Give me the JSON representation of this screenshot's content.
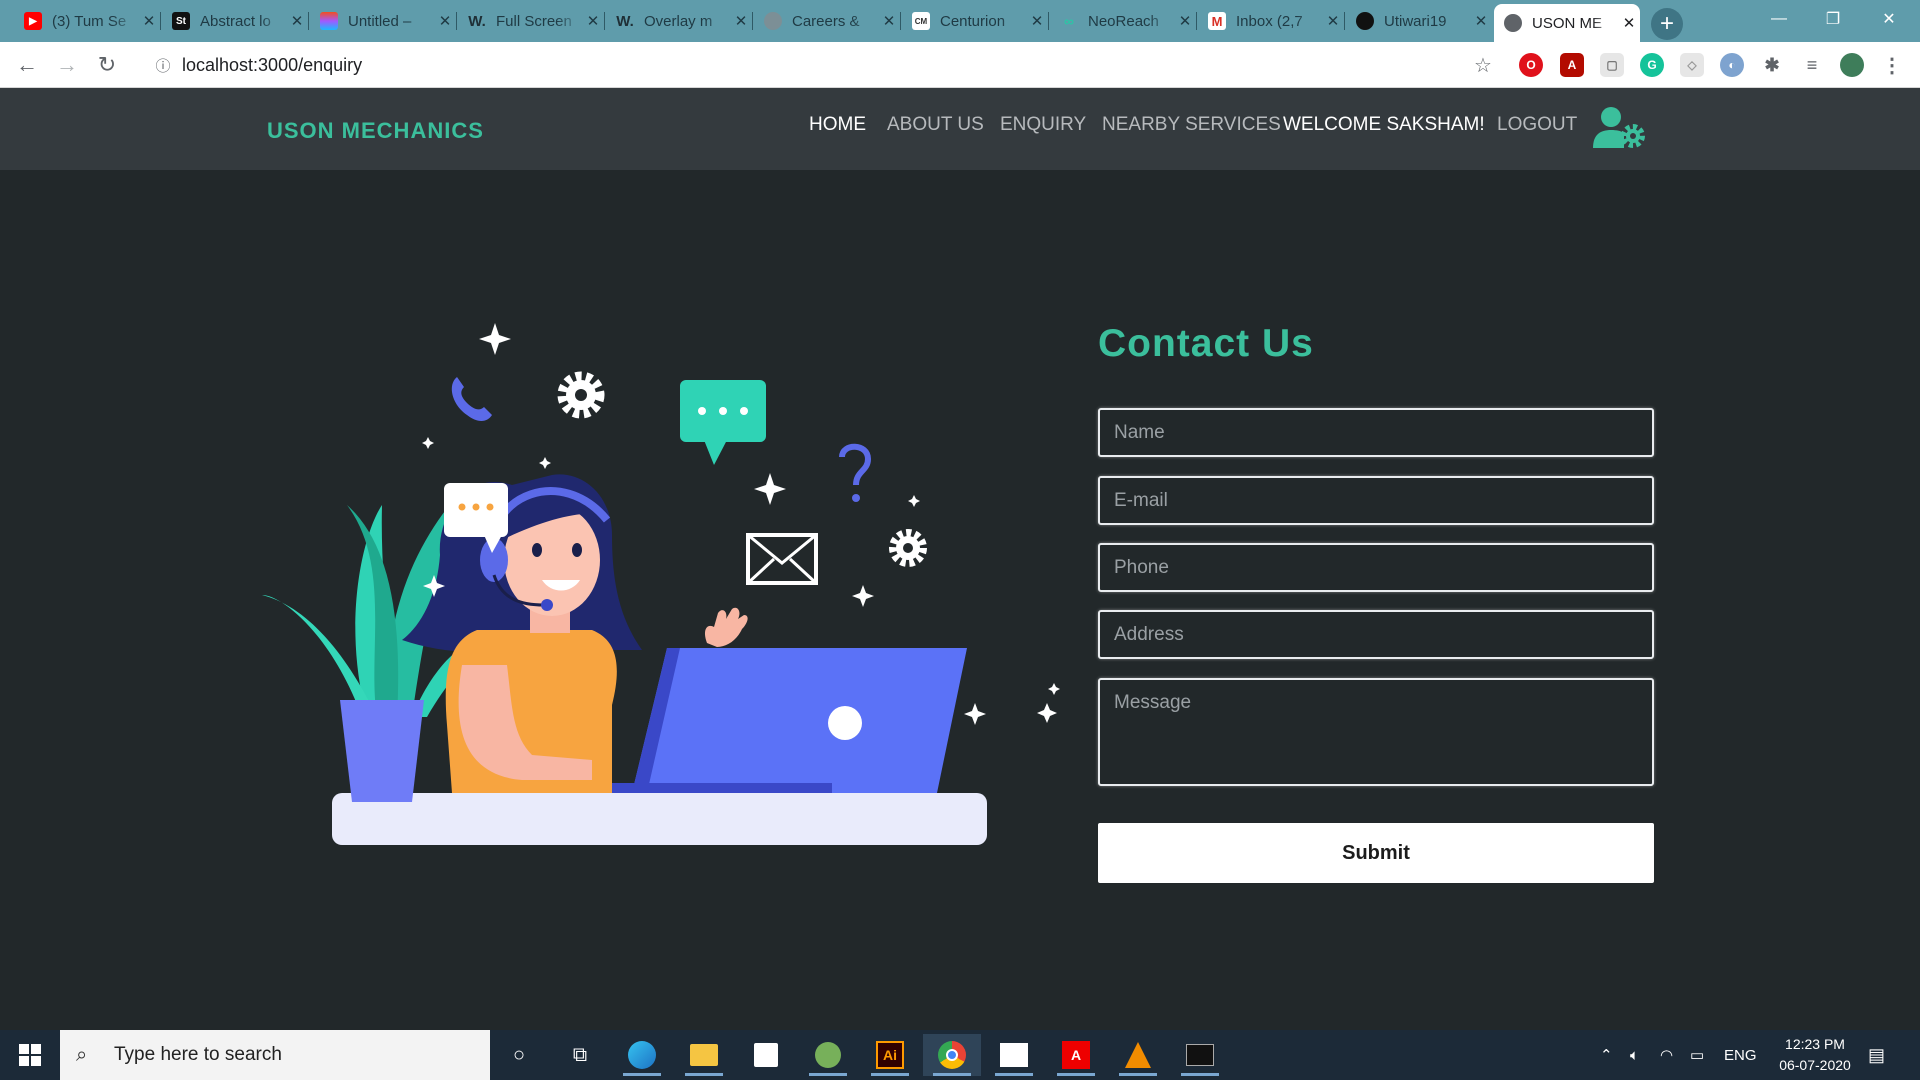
{
  "browser": {
    "tabs": [
      {
        "title": "(3) Tum Se",
        "icon": "youtube-icon",
        "color": "#ff0000"
      },
      {
        "title": "Abstract lo",
        "icon": "st-icon",
        "color": "#111111"
      },
      {
        "title": "Untitled –",
        "icon": "figma-icon",
        "color": "#a259ff"
      },
      {
        "title": "Full Screen",
        "icon": "w-icon",
        "color": "#222222"
      },
      {
        "title": "Overlay m",
        "icon": "w-icon",
        "color": "#222222"
      },
      {
        "title": "Careers &",
        "icon": "globe-icon",
        "color": "#555555"
      },
      {
        "title": "Centurion",
        "icon": "cm-icon",
        "color": "#444444"
      },
      {
        "title": "NeoReach",
        "icon": "neoreach-icon",
        "color": "#2ec4a6"
      },
      {
        "title": "Inbox (2,7",
        "icon": "gmail-icon",
        "color": "#d93025"
      },
      {
        "title": "Utiwari19",
        "icon": "github-icon",
        "color": "#111111"
      },
      {
        "title": "USON ME",
        "icon": "globe-icon",
        "color": "#555555"
      }
    ],
    "new_tab": "+",
    "url": "localhost:3000/enquiry"
  },
  "site": {
    "brand": "USON MECHANICS",
    "nav": [
      "HOME",
      "ABOUT US",
      "ENQUIRY",
      "NEARBY SERVICES",
      "WELCOME SAKSHAM!",
      "LOGOUT"
    ],
    "accent": "#3bbf9c"
  },
  "contact": {
    "title": "Contact Us",
    "name_placeholder": "Name",
    "email_placeholder": "E-mail",
    "phone_placeholder": "Phone",
    "address_placeholder": "Address",
    "message_placeholder": "Message",
    "submit_label": "Submit"
  },
  "taskbar": {
    "search_placeholder": "Type here to search",
    "lang": "ENG",
    "time": "12:23 PM",
    "date": "06-07-2020"
  }
}
